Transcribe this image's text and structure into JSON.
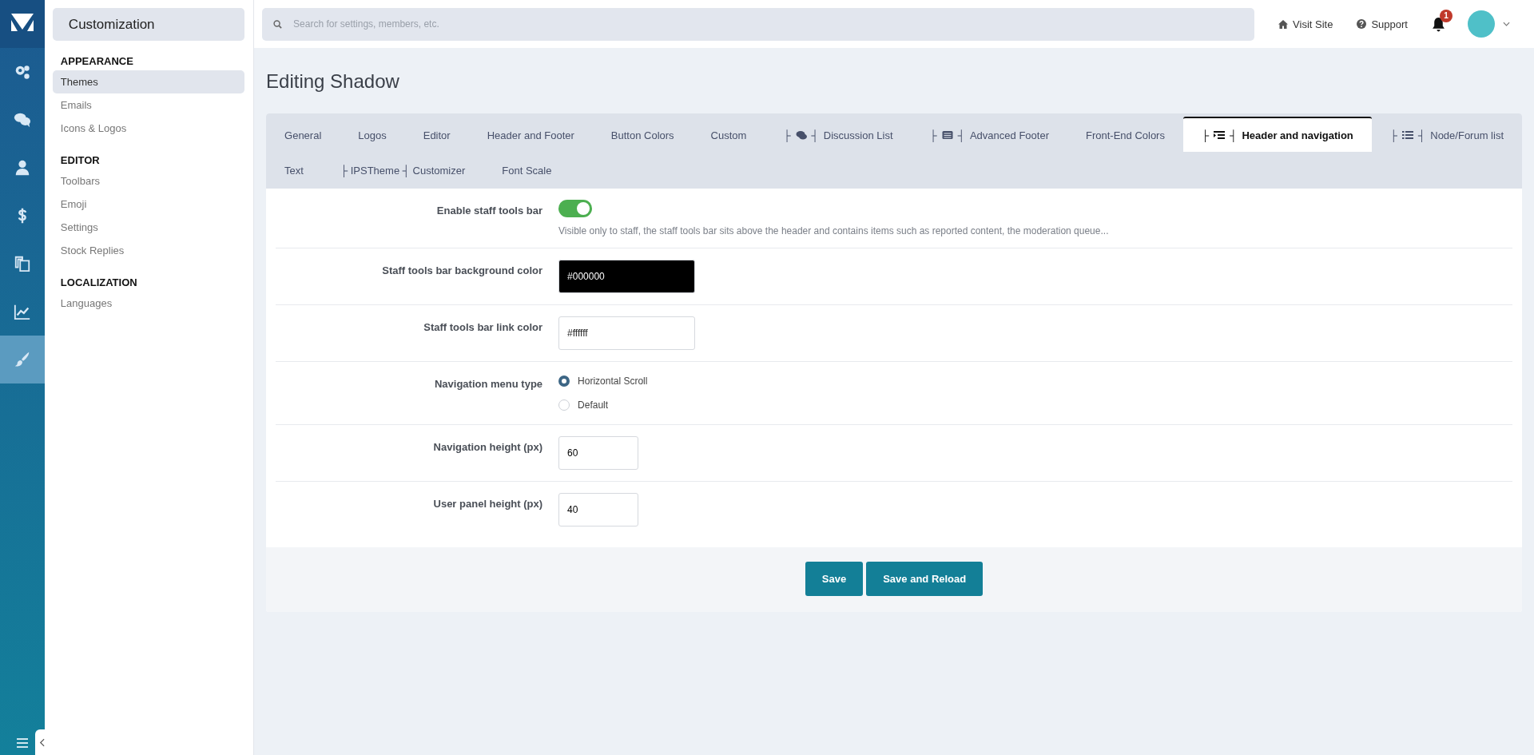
{
  "rail": [
    {
      "selected": false
    },
    {
      "selected": false
    },
    {
      "selected": false
    },
    {
      "selected": false
    },
    {
      "selected": false
    },
    {
      "selected": false
    },
    {
      "selected": true
    }
  ],
  "sidebar": {
    "title": "Customization",
    "sections": [
      {
        "heading": "APPEARANCE",
        "items": [
          {
            "label": "Themes",
            "selected": true
          },
          {
            "label": "Emails",
            "selected": false
          },
          {
            "label": "Icons & Logos",
            "selected": false
          }
        ]
      },
      {
        "heading": "EDITOR",
        "items": [
          {
            "label": "Toolbars",
            "selected": false
          },
          {
            "label": "Emoji",
            "selected": false
          },
          {
            "label": "Settings",
            "selected": false
          },
          {
            "label": "Stock Replies",
            "selected": false
          }
        ]
      },
      {
        "heading": "LOCALIZATION",
        "items": [
          {
            "label": "Languages",
            "selected": false
          }
        ]
      }
    ]
  },
  "search": {
    "placeholder": "Search for settings, members, etc."
  },
  "top_links": [
    "Visit Site",
    "Support"
  ],
  "notifications": {
    "count": "1"
  },
  "page_title": "Editing Shadow",
  "tabs": [
    [
      {
        "label": "General",
        "selected": false
      },
      {
        "label": "Logos",
        "selected": false
      },
      {
        "label": "Editor",
        "selected": false
      },
      {
        "label": "Header and Footer",
        "selected": false
      },
      {
        "label": "Button Colors",
        "selected": false
      },
      {
        "label": "Custom",
        "selected": false
      },
      {
        "label": "Discussion List",
        "left_mark": "├",
        "right_mark": "┤",
        "selected": false
      },
      {
        "label": "Advanced Footer",
        "left_mark": "├",
        "right_mark": "┤",
        "selected": false
      },
      {
        "label": "Front-End Colors",
        "selected": false
      },
      {
        "label": "Header and navigation",
        "left_mark": "├",
        "right_mark": "┤",
        "selected": true
      },
      {
        "label": "Node/Forum list",
        "left_mark": "├",
        "right_mark": "┤",
        "selected": false
      }
    ],
    [
      {
        "label": "Text",
        "selected": false
      },
      {
        "label": "├ IPSTheme ┤ Customizer",
        "selected": false
      },
      {
        "label": "Font Scale",
        "selected": false
      }
    ]
  ],
  "settings": [
    {
      "kind": "toggle",
      "label": "Enable staff tools bar",
      "on": true,
      "hint": "Visible only to staff, the staff tools bar sits above the header and contains items such as reported content, the moderation queue..."
    },
    {
      "kind": "color",
      "label": "Staff tools bar background color",
      "value": "#000000"
    },
    {
      "kind": "color",
      "label": "Staff tools bar link color",
      "value": "#ffffff"
    },
    {
      "kind": "radio",
      "label": "Navigation menu type",
      "options": [
        {
          "label": "Horizontal Scroll",
          "selected": true
        },
        {
          "label": "Default",
          "selected": false
        }
      ]
    },
    {
      "kind": "number",
      "label": "Navigation height (px)",
      "value": "60"
    },
    {
      "kind": "number",
      "label": "User panel height (px)",
      "value": "40"
    }
  ],
  "buttons": [
    "Save",
    "Save and Reload"
  ]
}
